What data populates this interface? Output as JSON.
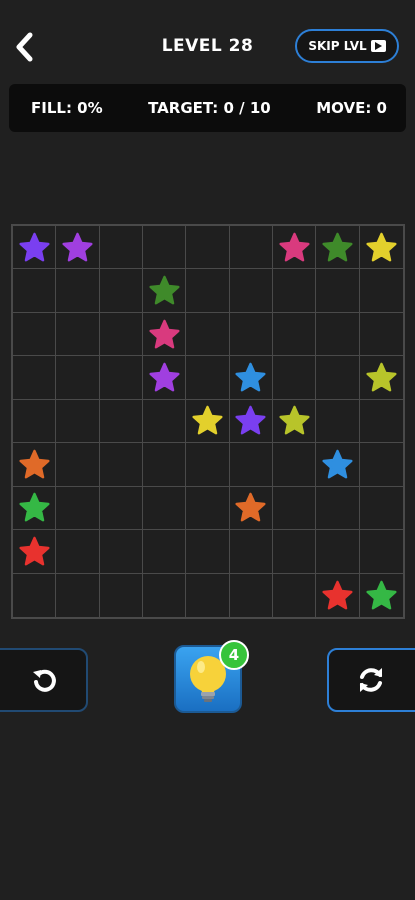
{
  "header": {
    "level_title": "LEVEL 28",
    "skip_label": "SKIP LVL"
  },
  "stats": {
    "fill": "FILL: 0%",
    "target": "TARGET: 0 / 10",
    "move": "MOVE: 0"
  },
  "board": {
    "rows": 9,
    "cols": 9,
    "stars": [
      {
        "row": 0,
        "col": 0,
        "color": "#7a3ff0"
      },
      {
        "row": 0,
        "col": 1,
        "color": "#a03fe0"
      },
      {
        "row": 0,
        "col": 6,
        "color": "#d93a7e"
      },
      {
        "row": 0,
        "col": 7,
        "color": "#3f8a2a"
      },
      {
        "row": 0,
        "col": 8,
        "color": "#e3d02c"
      },
      {
        "row": 1,
        "col": 3,
        "color": "#3f8a2a"
      },
      {
        "row": 2,
        "col": 3,
        "color": "#d93a7e"
      },
      {
        "row": 3,
        "col": 3,
        "color": "#a03fe0"
      },
      {
        "row": 3,
        "col": 5,
        "color": "#2f8fe0"
      },
      {
        "row": 3,
        "col": 8,
        "color": "#b8c42a"
      },
      {
        "row": 4,
        "col": 4,
        "color": "#e3d02c"
      },
      {
        "row": 4,
        "col": 5,
        "color": "#7a3ff0"
      },
      {
        "row": 4,
        "col": 6,
        "color": "#b8c42a"
      },
      {
        "row": 5,
        "col": 0,
        "color": "#e06a28"
      },
      {
        "row": 5,
        "col": 7,
        "color": "#2f8fe0"
      },
      {
        "row": 6,
        "col": 0,
        "color": "#35b845"
      },
      {
        "row": 6,
        "col": 5,
        "color": "#e06a28"
      },
      {
        "row": 7,
        "col": 0,
        "color": "#e8322e"
      },
      {
        "row": 8,
        "col": 7,
        "color": "#e8322e"
      },
      {
        "row": 8,
        "col": 8,
        "color": "#35b845"
      }
    ]
  },
  "controls": {
    "undo_icon": "undo-icon",
    "hint_icon": "lightbulb-icon",
    "hint_count": "4",
    "restart_icon": "restart-icon"
  }
}
